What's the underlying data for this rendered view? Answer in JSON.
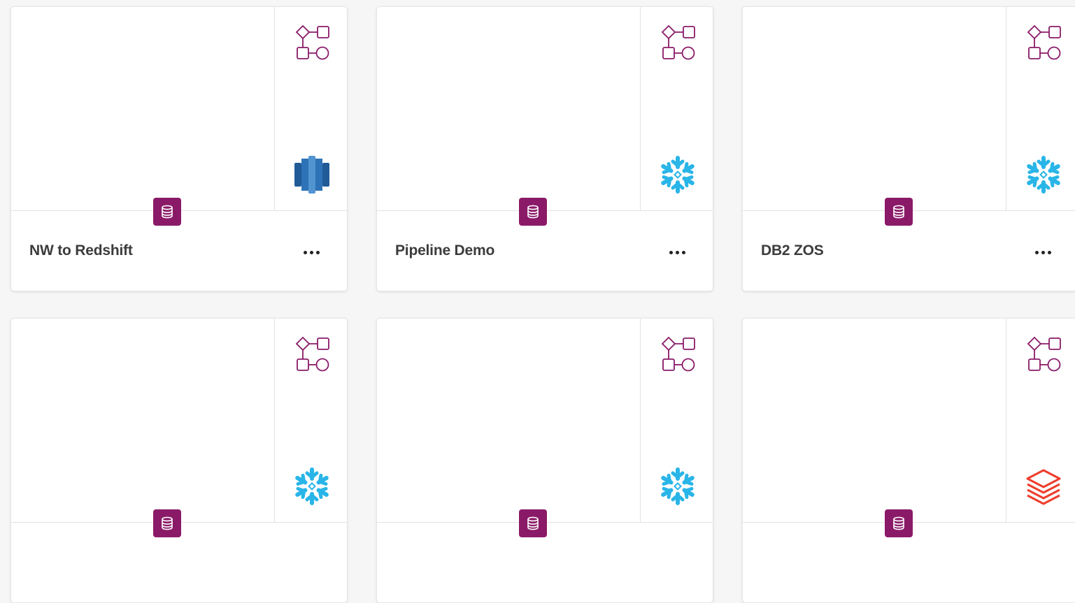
{
  "cards": [
    {
      "title": "NW to Redshift",
      "target_icon": "redshift-icon",
      "badge_icon": "database-icon",
      "flow_icon": "data-pipeline-icon"
    },
    {
      "title": "Pipeline Demo",
      "target_icon": "snowflake-icon",
      "badge_icon": "database-icon",
      "flow_icon": "data-pipeline-icon"
    },
    {
      "title": "DB2 ZOS",
      "target_icon": "snowflake-icon",
      "badge_icon": "database-icon",
      "flow_icon": "data-pipeline-icon"
    },
    {
      "title": "",
      "target_icon": "snowflake-icon",
      "badge_icon": "database-icon",
      "flow_icon": "data-pipeline-icon"
    },
    {
      "title": "",
      "target_icon": "snowflake-icon",
      "badge_icon": "database-icon",
      "flow_icon": "data-pipeline-icon"
    },
    {
      "title": "",
      "target_icon": "databricks-icon",
      "badge_icon": "database-icon",
      "flow_icon": "data-pipeline-icon"
    }
  ],
  "colors": {
    "badge": "#8a1a68",
    "flow_icon": "#8a1a68",
    "snowflake": "#29b5e8",
    "redshift_dark": "#205b98",
    "redshift_light": "#5294cf",
    "databricks": "#ee3d2c",
    "background": "#f6f6f6"
  }
}
